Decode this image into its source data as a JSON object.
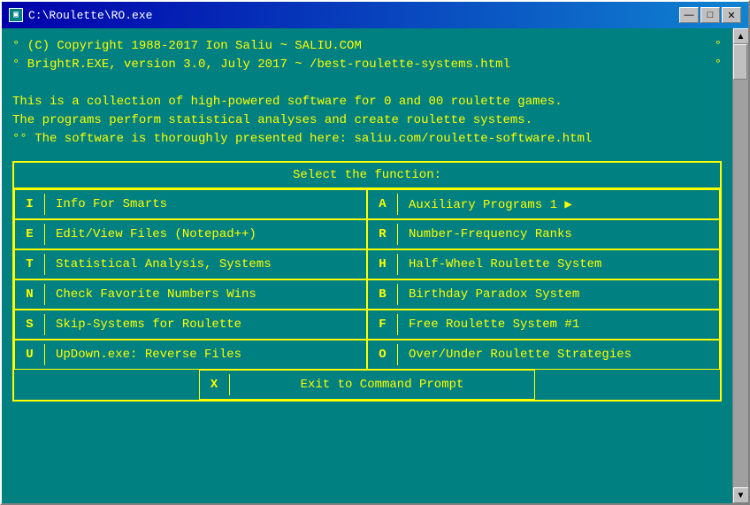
{
  "window": {
    "title": "C:\\Roulette\\RO.exe",
    "title_icon": "▣"
  },
  "controls": {
    "minimize": "—",
    "maximize": "□",
    "close": "✕"
  },
  "terminal": {
    "line1_left": "° (C) Copyright 1988-2017 Ion Saliu ~ SALIU.COM",
    "line1_right": "°",
    "line2_left": "° BrightR.EXE, version 3.0, July 2017 ~ /best-roulette-systems.html",
    "line2_right": "°",
    "line3": "",
    "line4": "This is a collection of high-powered software for 0 and 00 roulette games.",
    "line5": "The programs perform statistical analyses and create roulette systems.",
    "line6": "°° The software is thoroughly presented here: saliu.com/roulette-software.html"
  },
  "menu": {
    "header": "Select the function:",
    "items_left": [
      {
        "key": "I",
        "label": "Info For Smarts"
      },
      {
        "key": "E",
        "label": "Edit/View Files (Notepad++)"
      },
      {
        "key": "T",
        "label": "Statistical Analysis, Systems"
      },
      {
        "key": "N",
        "label": "Check Favorite Numbers Wins"
      },
      {
        "key": "S",
        "label": "Skip-Systems for Roulette"
      },
      {
        "key": "U",
        "label": "UpDown.exe: Reverse Files"
      }
    ],
    "items_right": [
      {
        "key": "A",
        "label": "Auxiliary Programs 1 ▶"
      },
      {
        "key": "R",
        "label": "Number-Frequency Ranks"
      },
      {
        "key": "H",
        "label": "Half-Wheel Roulette System"
      },
      {
        "key": "B",
        "label": "Birthday Paradox System"
      },
      {
        "key": "F",
        "label": "Free Roulette System #1"
      },
      {
        "key": "O",
        "label": "Over/Under Roulette Strategies"
      }
    ],
    "exit": {
      "key": "X",
      "label": "Exit to Command Prompt"
    }
  }
}
